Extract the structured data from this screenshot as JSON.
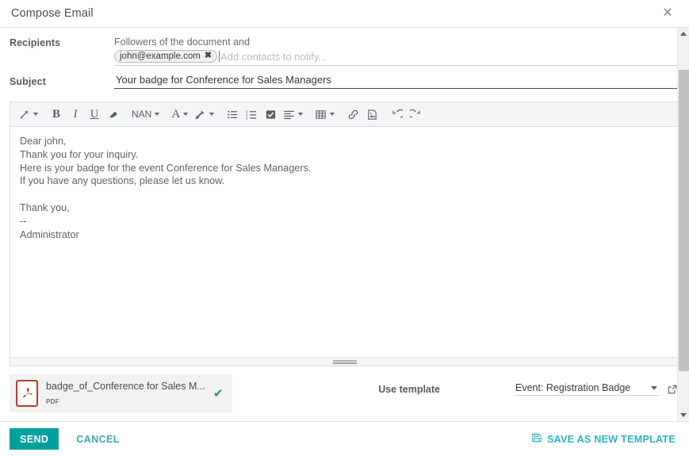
{
  "header": {
    "title": "Compose Email",
    "close_icon": "close-icon"
  },
  "recipients": {
    "label": "Recipients",
    "followers_note": "Followers of the document and",
    "chips": [
      {
        "text": "john@example.com",
        "remove_glyph": "✖"
      }
    ],
    "placeholder": "Add contacts to notify...",
    "value": ""
  },
  "subject": {
    "label": "Subject",
    "value": "Your badge for Conference for Sales Managers",
    "placeholder": "Subject"
  },
  "toolbar": {
    "items": [
      {
        "name": "style-picker",
        "label": "✒",
        "caret": true
      },
      {
        "name": "bold",
        "label": "B",
        "caret": false
      },
      {
        "name": "italic",
        "label": "I",
        "caret": false
      },
      {
        "name": "underline",
        "label": "U",
        "caret": false
      },
      {
        "name": "clear-formatting",
        "label": "▱",
        "caret": false
      },
      {
        "name": "font-size",
        "label": "NAN",
        "caret": true
      },
      {
        "name": "font-color",
        "label": "A",
        "caret": true
      },
      {
        "name": "highlight-color",
        "label": "✒",
        "caret": true
      },
      {
        "name": "unordered-list",
        "label": "",
        "caret": false
      },
      {
        "name": "ordered-list",
        "label": "",
        "caret": false
      },
      {
        "name": "checklist",
        "label": "",
        "caret": false
      },
      {
        "name": "align",
        "label": "",
        "caret": true
      },
      {
        "name": "table",
        "label": "",
        "caret": true
      },
      {
        "name": "link",
        "label": "",
        "caret": false
      },
      {
        "name": "image",
        "label": "",
        "caret": false
      },
      {
        "name": "undo",
        "label": "",
        "caret": false
      },
      {
        "name": "redo",
        "label": "",
        "caret": false
      }
    ]
  },
  "body": {
    "lines": [
      "Dear john,",
      "Thank you for your inquiry.",
      "Here is your badge for the event Conference for Sales Managers.",
      "If you have any questions, please let us know.",
      "",
      "Thank you,",
      "--",
      "Administrator"
    ]
  },
  "attachment": {
    "name": "badge_of_Conference for Sales M...",
    "type": "PDF",
    "status_glyph": "✔",
    "status_color": "#18a04a",
    "icon": "pdf-file-icon"
  },
  "template": {
    "label": "Use template",
    "selected": "Event: Registration Badge",
    "options": [
      "Event: Registration Badge"
    ],
    "external_link_icon": "external-link-icon"
  },
  "footer": {
    "send_label": "SEND",
    "cancel_label": "CANCEL",
    "save_template_label": "SAVE AS NEW TEMPLATE",
    "save_icon": "floppy-disk-icon"
  },
  "colors": {
    "accent_teal": "#00a09d",
    "link_teal": "#29b4c4",
    "pdf_red": "#c0392b",
    "check_green": "#18a04a"
  },
  "scrollbar": {
    "up_icon": "chevron-up-icon",
    "down_icon": "chevron-down-icon"
  }
}
